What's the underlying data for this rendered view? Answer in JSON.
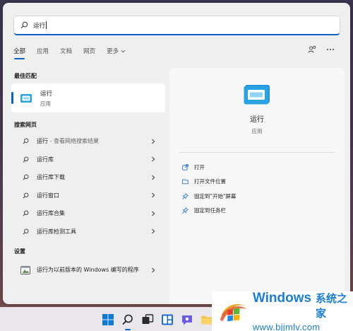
{
  "search": {
    "value": "运行"
  },
  "tabs": [
    "全部",
    "应用",
    "文档",
    "网页",
    "更多"
  ],
  "best_match": {
    "heading": "最佳匹配",
    "title": "运行",
    "subtitle": "应用"
  },
  "web": {
    "heading": "搜索网页",
    "items": [
      {
        "label": "运行",
        "hint": " - 查看网络搜索结果"
      },
      {
        "label": "运行库"
      },
      {
        "label": "运行库下载"
      },
      {
        "label": "运行窗口"
      },
      {
        "label": "运行库合集"
      },
      {
        "label": "运行库检测工具"
      }
    ]
  },
  "settings": {
    "heading": "设置",
    "item": "运行为以前版本的 Windows 编写的程序"
  },
  "preview": {
    "title": "运行",
    "subtitle": "应用"
  },
  "actions": [
    {
      "icon": "open-icon",
      "label": "打开"
    },
    {
      "icon": "folder-icon",
      "label": "打开文件位置"
    },
    {
      "icon": "pin-icon",
      "label": "固定到\"开始\"屏幕"
    },
    {
      "icon": "pin-icon",
      "label": "固定到任务栏"
    }
  ],
  "watermark": {
    "brand": "Windows",
    "cn": "系统之家",
    "url": "www.bjjmlv.com"
  },
  "colors": {
    "accent": "#0b62c4",
    "watermark": "#1a7ed6"
  }
}
